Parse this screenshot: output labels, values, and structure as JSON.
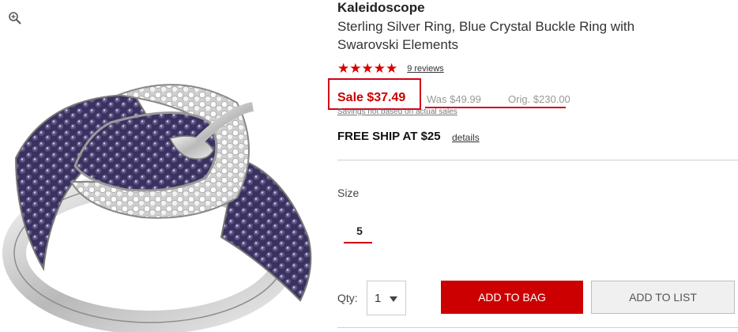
{
  "product": {
    "brand": "Kaleidoscope",
    "title": "Sterling Silver Ring, Blue Crystal Buckle Ring with Swarovski Elements",
    "stars": "★★★★★",
    "reviews_link": "9 reviews"
  },
  "pricing": {
    "sale": "Sale $37.49",
    "was": "Was $49.99",
    "orig": "Orig. $230.00",
    "savings_note": "Savings not based on actual sales"
  },
  "shipping": {
    "text": "FREE SHIP AT $25",
    "details_link": "details"
  },
  "size": {
    "label": "Size",
    "selected": "5"
  },
  "quantity": {
    "label": "Qty:",
    "value": "1"
  },
  "buttons": {
    "add_to_bag": "ADD TO BAG",
    "add_to_list": "ADD TO LIST"
  },
  "colors": {
    "accent_red": "#cc0000",
    "annotation_red": "#d0021b",
    "crystal_purple": "#4b3f6e"
  },
  "icons": {
    "zoom": "zoom-in-icon"
  }
}
